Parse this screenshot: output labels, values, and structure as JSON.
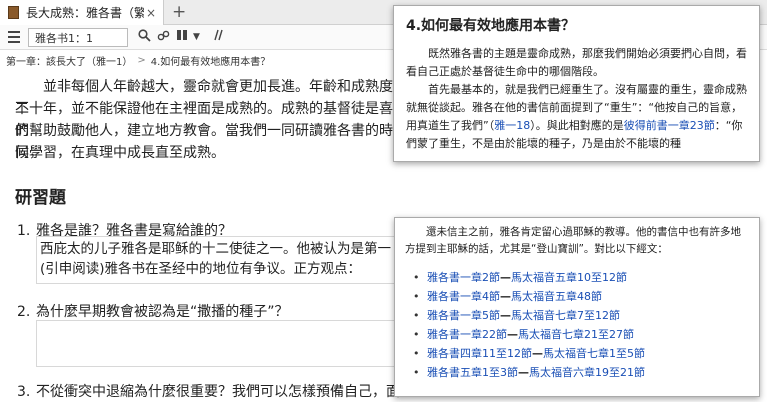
{
  "tab": {
    "title": "長大成熟：雅各書（繁體）",
    "close": "×",
    "new": "+"
  },
  "toolbar": {
    "reference": "雅各书1：1",
    "icons": [
      "search-icon",
      "link-icon",
      "columns-icon",
      "dropdown-icon",
      "parallel-icon"
    ]
  },
  "breadcrumb": {
    "items": [
      "第一章：該長大了（雅一1）",
      "4.如何最有效地應用本書？"
    ]
  },
  "main": {
    "para_lines": [
      "並非每個人年齡越大，靈命就會更加長進。年齡和成熟度並不",
      "二十年，並不能保證他在主裡面是成熟的。成熟的基督徒是喜樂的",
      "們幫助鼓勵他人，建立地方教會。當我們一同研讀雅各書的時候，",
      "同學習，在真理中成長直至成熟。"
    ],
    "heading": "研習題",
    "questions": [
      {
        "num": "1.",
        "text": "雅各是誰？雅各書是寫給誰的？",
        "answer": [
          "西庇太的儿子雅各是耶稣的十二使徒之一。他被认为是第一",
          "(引申阅读)雅各书在圣经中的地位有争议。正方观点："
        ]
      },
      {
        "num": "2.",
        "text": "為什麼早期教會被認為是“撒播的種子”？",
        "answer": []
      },
      {
        "num": "3.",
        "text": "不從衝突中退縮為什麼很重要？我們可以怎樣預備自己，面對",
        "answer": []
      }
    ]
  },
  "popup1": {
    "title": "4.如何最有效地應用本書？",
    "p1": "既然雅各書的主題是靈命成熟，那麼我們開始必須要捫心自問，看看自己正處於基督徒生命中的哪個階段。",
    "p2_a": "首先最基本的，就是我們已經重生了。沒有屬靈的重生，靈命成熟就無從談起。雅各在他的書信前面提到了“重生”：“他按自己的旨意，用真道生了我們”（",
    "p2_link1": "雅一18",
    "p2_b": "）。與此相對應的是",
    "p2_link2": "彼得前書一章23節",
    "p2_c": "：“你們蒙了重生，不是由於能壞的種子，乃是由於不能壞的種"
  },
  "popup2": {
    "intro": "還未信主之前，雅各肯定留心過耶穌的教導。他的書信中也有許多地方提到主耶穌的話，尤其是“登山寶訓”。對比以下經文：",
    "separator": "—",
    "refs": [
      {
        "a": "雅各書一章2節",
        "b": "馬太福音五章10至12節"
      },
      {
        "a": "雅各書一章4節",
        "b": "馬太福音五章48節"
      },
      {
        "a": "雅各書一章5節",
        "b": "馬太福音七章7至12節"
      },
      {
        "a": "雅各書一章22節",
        "b": "馬太福音七章21至27節"
      },
      {
        "a": "雅各書四章11至12節",
        "b": "馬太福音七章1至5節"
      },
      {
        "a": "雅各書五章1至3節",
        "b": "馬太福音六章19至21節"
      }
    ]
  },
  "colors": {
    "link": "#1a4fb5",
    "tab_bg": "#ececec"
  }
}
